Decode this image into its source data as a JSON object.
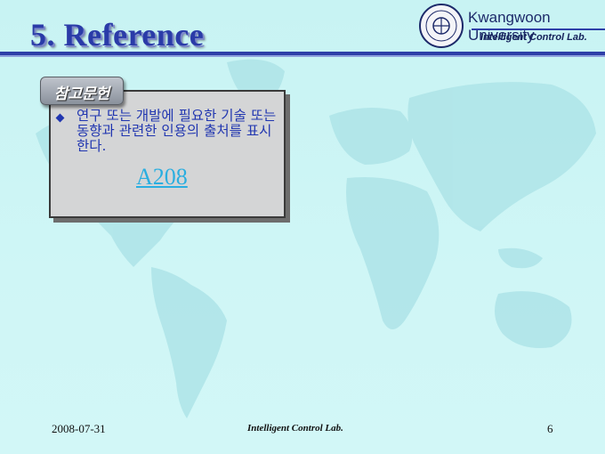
{
  "slide": {
    "title": "5. Reference",
    "logo": {
      "university": "Kwangwoon University",
      "lab": "Intelligent Control Lab."
    },
    "tag_label": "참고문헌",
    "bullet_text": "연구 또는 개발에 필요한 기술 또는 동향과 관련한 인용의 출처를 표시한다.",
    "link_text": "A208"
  },
  "footer": {
    "date": "2008-07-31",
    "lab": "Intelligent Control Lab.",
    "page": "6"
  },
  "colors": {
    "title": "#2a3ba8",
    "body_text": "#2136b0",
    "link": "#2aaee0",
    "background": "#cdf5f5"
  }
}
